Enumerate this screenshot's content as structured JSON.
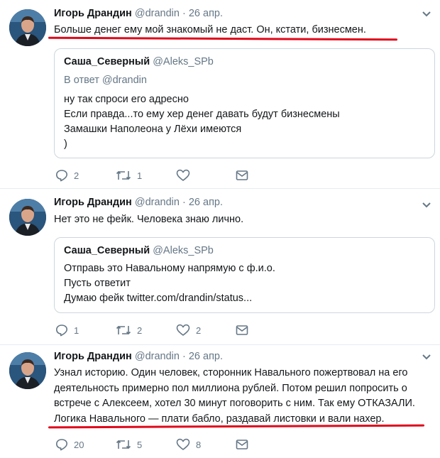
{
  "tweets": [
    {
      "author_name": "Игорь Драндин",
      "author_handle": "@drandin",
      "separator": "·",
      "date": "26 апр.",
      "text_lines": [
        "Больше денег ему мой знакомый не даст. Он, кстати, бизнесмен."
      ],
      "quote": {
        "name": "Саша_Северный",
        "handle": "@Aleks_SPb",
        "reply_to": "В ответ @drandin",
        "lines": [
          "ну так спроси его адресно",
          "Если правда...то ему хер денег давать будут бизнесмены",
          "Замашки Наполеона у Лёхи имеются",
          ")"
        ]
      },
      "actions": {
        "replies": "2",
        "retweets": "1",
        "likes": ""
      }
    },
    {
      "author_name": "Игорь Драндин",
      "author_handle": "@drandin",
      "separator": "·",
      "date": "26 апр.",
      "text_lines": [
        "Нет это не фейк. Человека знаю лично."
      ],
      "quote": {
        "name": "Саша_Северный",
        "handle": "@Aleks_SPb",
        "lines": [
          "Отправь это Навальному напрямую с ф.и.о.",
          "Пусть ответит",
          "Думаю фейк twitter.com/drandin/status..."
        ]
      },
      "actions": {
        "replies": "1",
        "retweets": "2",
        "likes": "2"
      }
    },
    {
      "author_name": "Игорь Драндин",
      "author_handle": "@drandin",
      "separator": "·",
      "date": "26 апр.",
      "text_lines": [
        "Узнал историю. Один человек, сторонник Навального пожертвовал на его",
        "деятельность примерно пол миллиона рублей. Потом решил попросить о",
        "встрече с Алексеем, хотел 30 минут поговорить с ним. Так ему ОТКАЗАЛИ.",
        "Логика Навального — плати бабло, раздавай листовки и вали нахер."
      ],
      "actions": {
        "replies": "20",
        "retweets": "5",
        "likes": "8"
      }
    }
  ],
  "icons": {
    "reply": "reply-icon",
    "retweet": "retweet-icon",
    "like": "heart-icon",
    "dm": "envelope-icon",
    "more": "chevron-down-icon"
  },
  "colors": {
    "underline": "#e0091b",
    "muted": "#657786",
    "border": "#ccd6dd"
  }
}
